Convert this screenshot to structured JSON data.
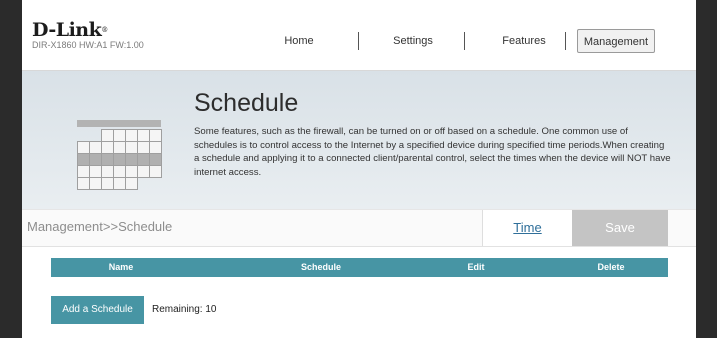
{
  "brand": {
    "logo_text": "D-Link",
    "logo_mark": "®",
    "device_info": "DIR-X1860 HW:A1 FW:1.00"
  },
  "nav": {
    "items": [
      {
        "label": "Home",
        "active": false
      },
      {
        "label": "Settings",
        "active": false
      },
      {
        "label": "Features",
        "active": false
      },
      {
        "label": "Management",
        "active": true
      }
    ]
  },
  "banner": {
    "title": "Schedule",
    "description": "Some features, such as the firewall, can be turned on or off based on a schedule. One common use of schedules is to control access to the Internet by a specified device during specified time periods.When creating a schedule and applying it to a connected client/parental control, select the times when the device will NOT have internet access.",
    "icon": "calendar-icon"
  },
  "action_bar": {
    "breadcrumb": "Management>>Schedule",
    "time_label": "Time",
    "save_label": "Save"
  },
  "table": {
    "columns": [
      "Name",
      "Schedule",
      "Edit",
      "Delete"
    ],
    "rows": []
  },
  "footer": {
    "add_label": "Add a Schedule",
    "remaining": "Remaining: 10"
  },
  "colors": {
    "accent": "#4795a4",
    "banner": "#dde4e9",
    "save_disabled": "#c4c4c4",
    "link": "#2f6f9a",
    "page_bg": "#2b2b2b"
  }
}
